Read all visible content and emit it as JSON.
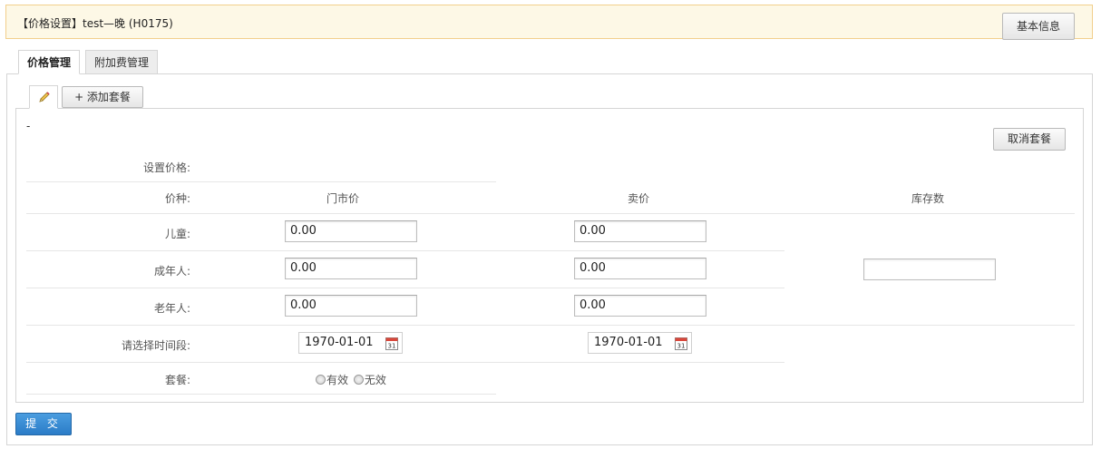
{
  "header": {
    "title": "【价格设置】test—晚 (H0175)",
    "basic_info_button": "基本信息"
  },
  "tabs": [
    {
      "label": "价格管理",
      "active": true
    },
    {
      "label": "附加费管理",
      "active": false
    }
  ],
  "subtabs": {
    "edit_icon": "pencil-icon",
    "add_package_button": "+ 添加套餐"
  },
  "package": {
    "dash": "-",
    "cancel_button": "取消套餐",
    "set_price_label": "设置价格:",
    "column_headers": {
      "type": "价种:",
      "market_price": "门市价",
      "sale_price": "卖价",
      "stock": "库存数"
    },
    "rows": [
      {
        "label": "儿童:",
        "market_price": "0.00",
        "sale_price": "0.00"
      },
      {
        "label": "成年人:",
        "market_price": "0.00",
        "sale_price": "0.00"
      },
      {
        "label": "老年人:",
        "market_price": "0.00",
        "sale_price": "0.00"
      }
    ],
    "stock_value": "",
    "period_label": "请选择时间段:",
    "start_date": "1970-01-01",
    "end_date": "1970-01-01",
    "calendar_icon": "calendar-icon",
    "status_label": "套餐:",
    "status_options": [
      "有效",
      "无效"
    ]
  },
  "submit_button": "提 交",
  "colors": {
    "header_bg": "#fdf8e6",
    "header_border": "#f2cf8c",
    "submit_bg": "#2b7cc7"
  }
}
